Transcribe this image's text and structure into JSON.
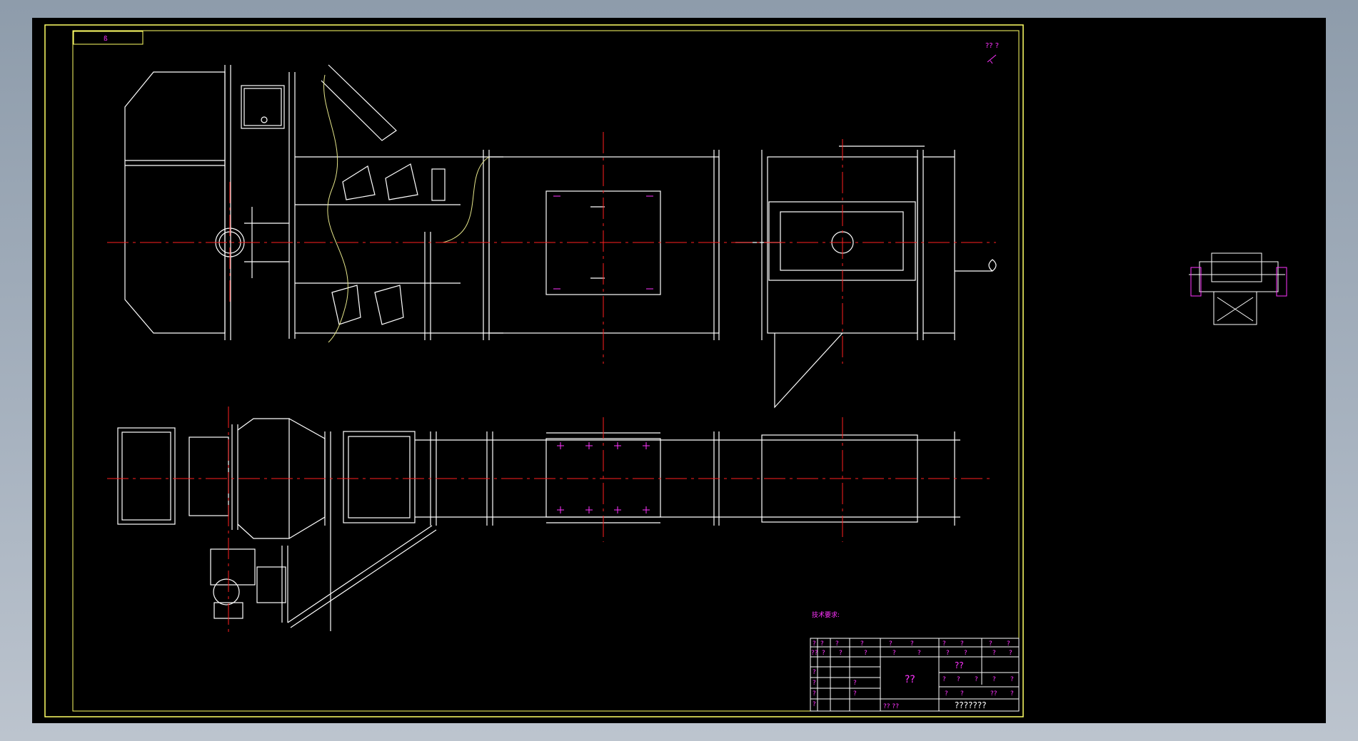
{
  "colors": {
    "background": "#000000",
    "frame": "#ffff66",
    "geometry": "#ffffff",
    "centerline": "#ff2020",
    "annotation": "#ff33ff",
    "edge": "#00ffff"
  },
  "corner_tag": "ß",
  "north_note": "?? ?",
  "tech_note": "技术要求:",
  "title_block": {
    "header_cells": [
      "?",
      "?",
      "?",
      "?",
      "?",
      "?",
      "?",
      "?",
      "?",
      "?"
    ],
    "row2_cells": [
      "??",
      "?",
      "?",
      "?",
      "?",
      "?",
      "?",
      "?",
      "?",
      "?"
    ],
    "part_name": "??",
    "material": "??",
    "left_labels": [
      "?",
      "?",
      "?",
      "?",
      "?",
      "?"
    ],
    "right_labels": [
      "?",
      "?",
      "?",
      "?",
      "?"
    ],
    "scale_cells": [
      "?",
      "?",
      "??",
      "?"
    ],
    "signature": "?? ??",
    "drawing_number": "???????"
  }
}
